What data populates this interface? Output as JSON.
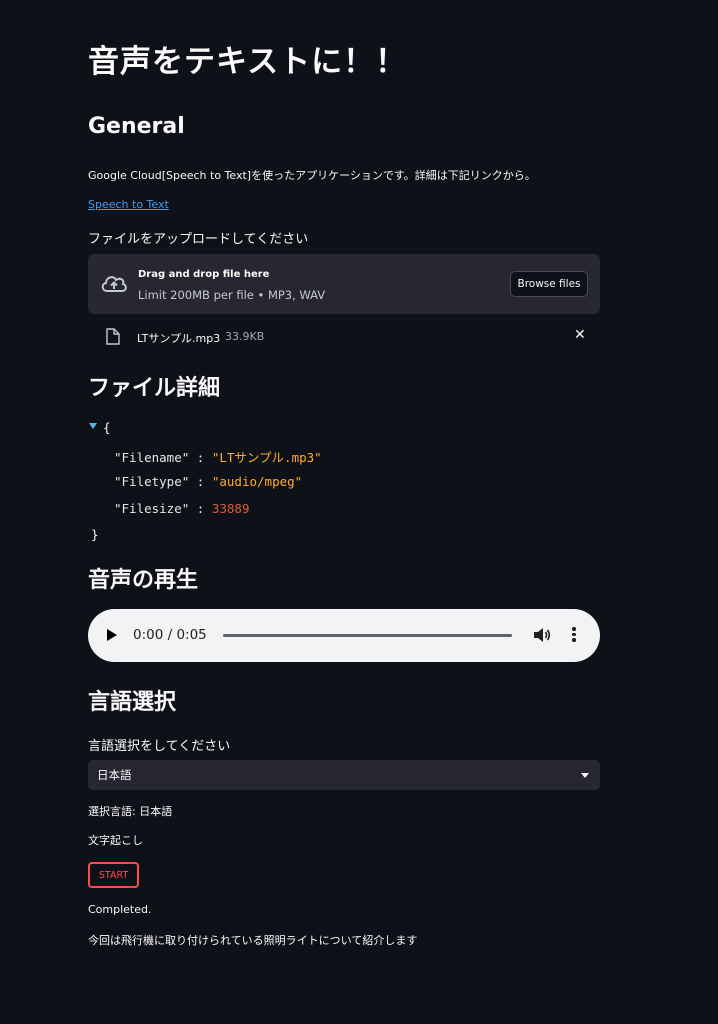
{
  "page": {
    "title": "音声をテキストに！！",
    "general_heading": "General",
    "intro_text": "Google Cloud[Speech to Text]を使ったアプリケーションです。詳細は下記リンクから。",
    "link_text": "Speech to Text"
  },
  "uploader": {
    "label": "ファイルをアップロードしてください",
    "drop_title": "Drag and drop file here",
    "limit_text": "Limit 200MB per file • MP3, WAV",
    "browse_label": "Browse files",
    "icon": "cloud-upload-icon",
    "file": {
      "name": "LTサンプル.mp3",
      "size": "33.9KB",
      "close": "✕"
    }
  },
  "details": {
    "heading": "ファイル詳細",
    "open_brace": "{",
    "close_brace": "}",
    "rows": [
      {
        "key": "\"Filename\"",
        "value": "\"LTサンプル.mp3\""
      },
      {
        "key": "\"Filetype\"",
        "value": "\"audio/mpeg\""
      },
      {
        "key": "\"Filesize\"",
        "value": "33889"
      }
    ],
    "colon": ":"
  },
  "player": {
    "heading": "音声の再生",
    "time": "0:00 / 0:05",
    "progress": 0
  },
  "language": {
    "heading": "言語選択",
    "label": "言語選択をしてください",
    "selected": "日本語",
    "selected_text": "選択言語: 日本語"
  },
  "transcribe": {
    "label": "文字起こし",
    "start_label": "START",
    "status": "Completed.",
    "result": "今回は飛行機に取り付けられている照明ライトについて紹介します"
  },
  "colors": {
    "background": "#0e1117",
    "accent": "#ff4b4b",
    "link": "#3d9df6",
    "json_string": "#ffab2e",
    "json_number": "#d95f35"
  }
}
